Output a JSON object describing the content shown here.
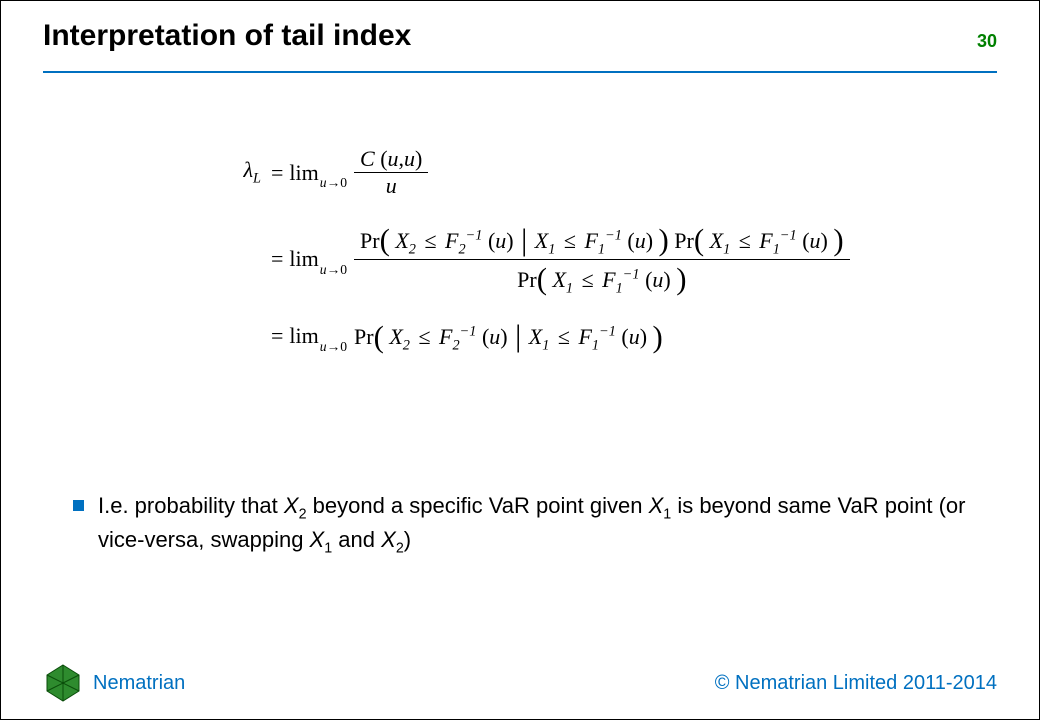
{
  "header": {
    "title": "Interpretation of tail index",
    "page_number": "30"
  },
  "equation": {
    "lhs_symbol": "λ",
    "lhs_sub": "L",
    "equals": "=",
    "lim_word": "lim",
    "lim_sub_var": "u",
    "lim_sub_arrow": "→0",
    "line1_num": "C (u,u)",
    "line1_den": "u",
    "line2_num_left": "Pr",
    "line2_cond1_a": "X",
    "line2_cond1_a_sub": "2",
    "line2_le": "≤",
    "line2_F2": "F",
    "line2_F2_sub": "2",
    "line2_F_sup": "−1",
    "line2_cond1_b": "X",
    "line2_cond1_b_sub": "1",
    "line2_F1": "F",
    "line2_F1_sub": "1",
    "line2_u": "u",
    "line2_Pr": "Pr",
    "line2_den_Pr": "Pr",
    "line3_Pr": "Pr"
  },
  "bullet": {
    "pre": "I.e. probability that ",
    "x2": "X",
    "x2_sub": "2",
    "mid1": " beyond a specific VaR point given ",
    "x1": "X",
    "x1_sub": "1",
    "mid2": " is beyond same VaR point (or vice-versa, swapping ",
    "x1b": "X",
    "x1b_sub": "1",
    "mid3": " and ",
    "x2b": "X",
    "x2b_sub": "2",
    "end": ")"
  },
  "footer": {
    "brand": "Nematrian",
    "copyright": "© Nematrian Limited 2011-2014"
  }
}
